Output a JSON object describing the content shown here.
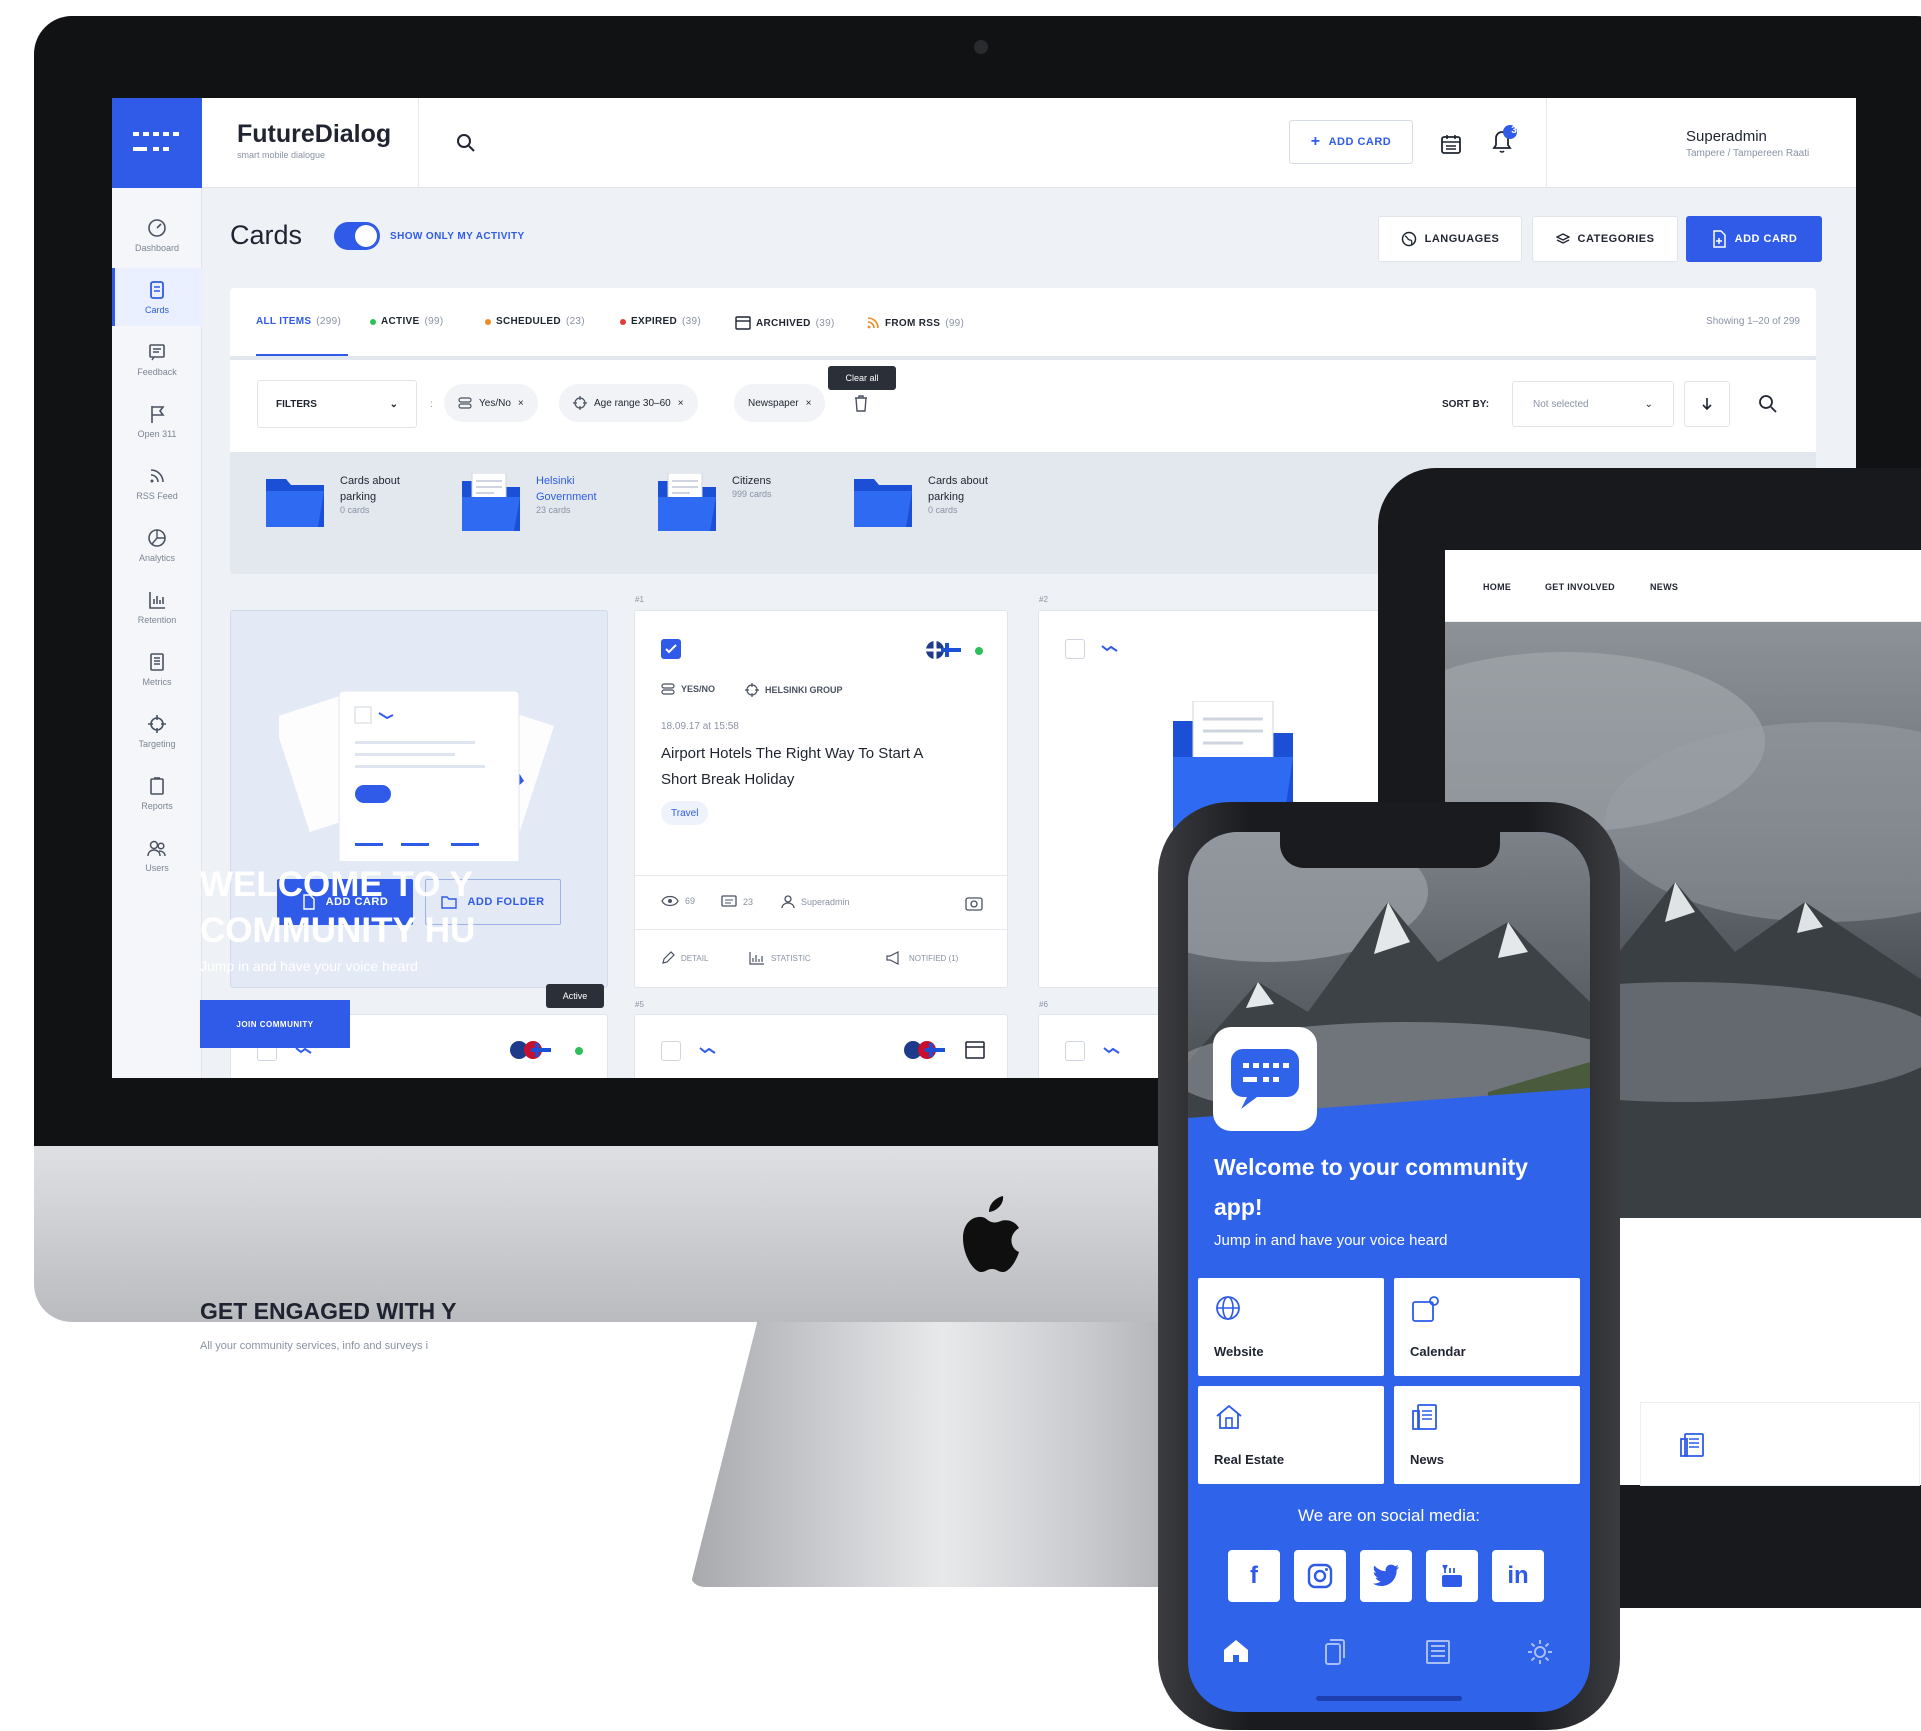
{
  "app": {
    "brand": "FutureDialog",
    "brand_sub": "smart mobile dialogue",
    "top_add_card": "ADD CARD",
    "notif_count": "3",
    "user_name": "Superadmin",
    "user_location": "Tampere / Tampereen Raati"
  },
  "sidebar": {
    "items": [
      {
        "label": "Dashboard",
        "icon": "dashboard-icon"
      },
      {
        "label": "Cards",
        "icon": "cards-icon"
      },
      {
        "label": "Feedback",
        "icon": "feedback-icon"
      },
      {
        "label": "Open 311",
        "icon": "flag-icon"
      },
      {
        "label": "RSS Feed",
        "icon": "rss-icon"
      },
      {
        "label": "Analytics",
        "icon": "analytics-icon"
      },
      {
        "label": "Retention",
        "icon": "retention-icon"
      },
      {
        "label": "Metrics",
        "icon": "metrics-icon"
      },
      {
        "label": "Targeting",
        "icon": "targeting-icon"
      },
      {
        "label": "Reports",
        "icon": "reports-icon"
      },
      {
        "label": "Users",
        "icon": "users-icon"
      }
    ]
  },
  "header": {
    "title": "Cards",
    "toggle_label": "SHOW ONLY MY ACTIVITY",
    "languages": "LANGUAGES",
    "categories": "CATEGORIES",
    "add_card": "ADD CARD"
  },
  "tabs": [
    {
      "label": "ALL ITEMS",
      "count": "(299)",
      "color": "#2f5be8"
    },
    {
      "label": "ACTIVE",
      "count": "(99)",
      "color": "#2fbf5a"
    },
    {
      "label": "SCHEDULED",
      "count": "(23)",
      "color": "#f08a24"
    },
    {
      "label": "EXPIRED",
      "count": "(39)",
      "color": "#e23b3b"
    },
    {
      "label": "ARCHIVED",
      "count": "(39)",
      "color": "#1f2430"
    },
    {
      "label": "FROM RSS",
      "count": "(99)",
      "color": "#f08a24"
    }
  ],
  "showing": "Showing 1–20 of 299",
  "filters": {
    "select_label": "FILTERS",
    "chips": [
      "Yes/No",
      "Age range 30–60",
      "Newspaper"
    ],
    "clear_tooltip": "Clear all",
    "sort_label": "SORT BY:",
    "sort_value": "Not selected"
  },
  "folders": [
    {
      "name": "Cards about parking",
      "count": "0 cards"
    },
    {
      "name": "Helsinki Government",
      "count": "23 cards"
    },
    {
      "name": "Citizens",
      "count": "999 cards"
    },
    {
      "name": "Cards about parking",
      "count": "0 cards"
    }
  ],
  "add_panel": {
    "add_card": "ADD CARD",
    "add_folder": "ADD FOLDER"
  },
  "cards": {
    "no1": "#1",
    "no2": "#2",
    "no4": "#4",
    "no5": "#5",
    "no6": "#6",
    "card1": {
      "type": "YES/NO",
      "group": "HELSINKI GROUP",
      "date": "18.09.17 at 15:58",
      "title": "Airport Hotels The Right Way To Start A Short Break Holiday",
      "tag": "Travel",
      "views": "69",
      "comments": "23",
      "author": "Superadmin",
      "detail": "DETAIL",
      "statistic": "STATISTIC",
      "notified": "NOTIFIED (1)"
    },
    "active_tooltip": "Active"
  },
  "tablet": {
    "nav": [
      "HOME",
      "GET INVOLVED",
      "NEWS"
    ],
    "hero_title": "WELCOME TO Y COMMUNITY HU",
    "hero_sub": "Jump in and have your voice heard",
    "join": "JOIN COMMUNITY",
    "engaged": "GET ENGAGED WITH Y",
    "engaged_sub": "All your community services, info and surveys i"
  },
  "phone": {
    "title": "Welcome to your community app!",
    "sub": "Jump in and have your voice heard",
    "tiles": [
      "Website",
      "Calendar",
      "Real Estate",
      "News"
    ],
    "social_title": "We are on social media:",
    "social": [
      "f",
      "instagram-icon",
      "twitter-icon",
      "youtube-icon",
      "in"
    ]
  },
  "colors": {
    "brand_blue": "#2f5be8",
    "phone_blue": "#2f63ea"
  }
}
